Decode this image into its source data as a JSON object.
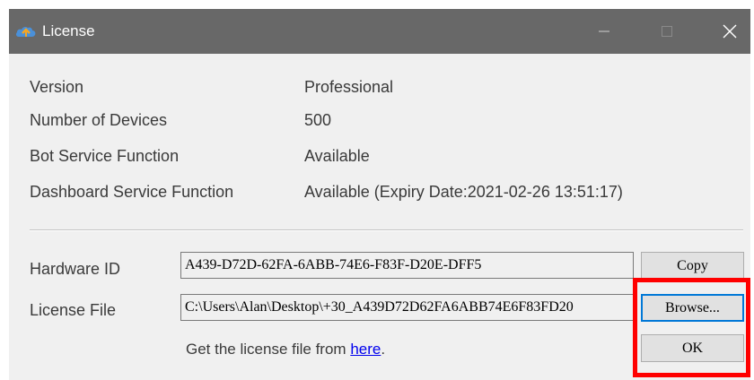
{
  "window": {
    "title": "License",
    "app_icon": "cloud-app-icon",
    "controls": {
      "minimize": "minimize-icon",
      "maximize": "maximize-icon",
      "close": "close-icon"
    }
  },
  "info": [
    {
      "label": "Version",
      "value": "Professional"
    },
    {
      "label": "Number of Devices",
      "value": "500"
    },
    {
      "label": "Bot Service Function",
      "value": "Available"
    },
    {
      "label": "Dashboard Service Function",
      "value": "Available (Expiry Date:2021-02-26 13:51:17)"
    }
  ],
  "hardware": {
    "label": "Hardware ID",
    "value": "A439-D72D-62FA-6ABB-74E6-F83F-D20E-DFF5",
    "copy_button": "Copy"
  },
  "license_file": {
    "label": "License File",
    "value": "C:\\Users\\Alan\\Desktop\\+30_A439D72D62FA6ABB74E6F83FD20",
    "browse_button": "Browse...",
    "hint_prefix": "Get the license file from ",
    "hint_link": "here",
    "hint_suffix": "."
  },
  "ok_button": "OK",
  "colors": {
    "titlebar": "#686868",
    "window_bg": "#f0f0f0",
    "link": "#0000ee",
    "highlight": "#ff0000"
  }
}
